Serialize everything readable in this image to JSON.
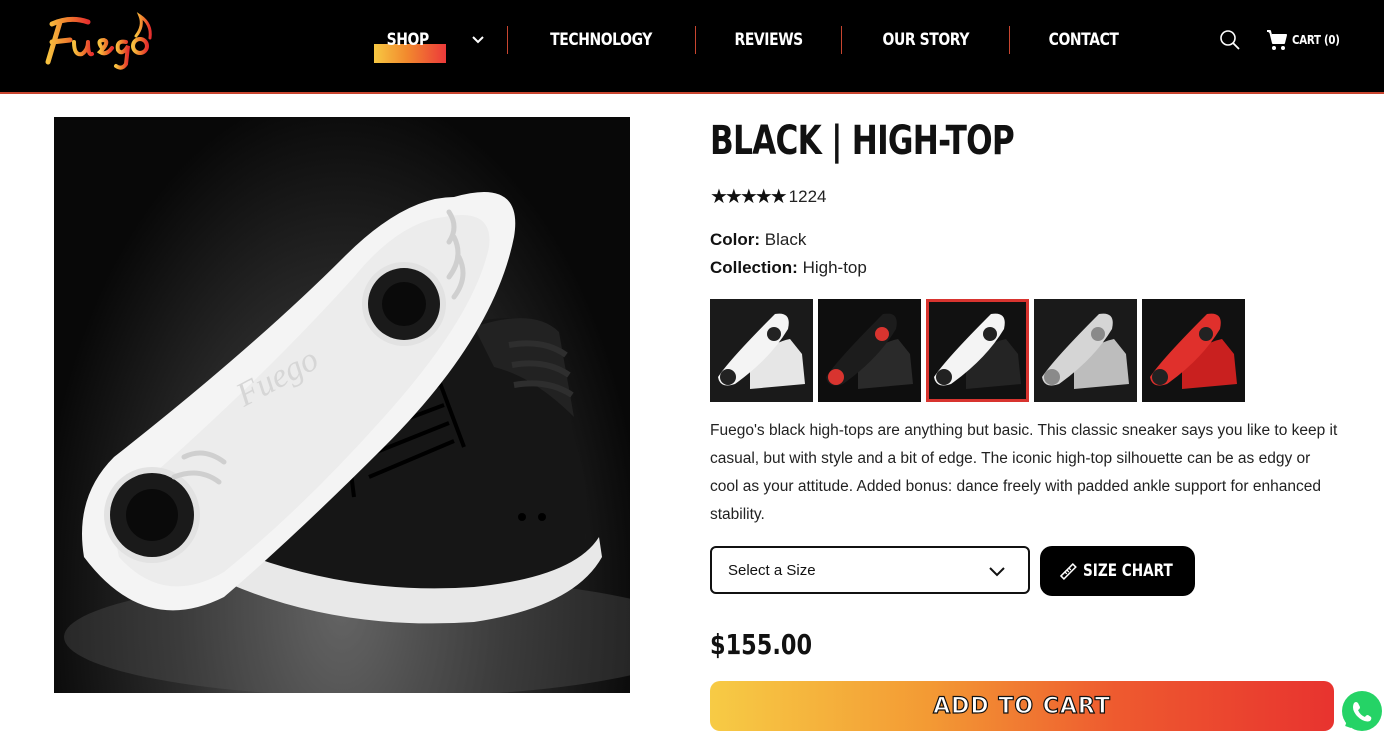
{
  "brand": {
    "logo_text": "Fuego"
  },
  "nav": {
    "items": [
      {
        "label": "SHOP"
      },
      {
        "label": "TECHNOLOGY"
      },
      {
        "label": "REVIEWS"
      },
      {
        "label": "OUR STORY"
      },
      {
        "label": "CONTACT"
      }
    ],
    "cart_label": "CART (0)"
  },
  "product": {
    "title": "BLACK | HIGH-TOP",
    "rating_stars": "★★★★★",
    "rating_value": 5,
    "review_count": "1224",
    "color_label": "Color:",
    "color_value": "Black",
    "collection_label": "Collection:",
    "collection_value": "High-top",
    "swatches": [
      {
        "name": "white",
        "selected": false
      },
      {
        "name": "black-red",
        "selected": false
      },
      {
        "name": "black",
        "selected": true
      },
      {
        "name": "silver",
        "selected": false
      },
      {
        "name": "red",
        "selected": false
      }
    ],
    "description": "Fuego's black high-tops are anything but basic. This classic sneaker says you like to keep it casual, but with style and a bit of edge. The iconic high-top silhouette can be as edgy or cool as your attitude. Added bonus: dance freely with padded ankle support for enhanced stability.",
    "size_select_value": "Select a Size",
    "size_chart_label": "SIZE CHART",
    "price": "$155.00",
    "add_to_cart_label": "ADD TO CART"
  },
  "colors": {
    "header_bg": "#000000",
    "accent_red": "#e8332f",
    "accent_yellow": "#f7cb45",
    "whatsapp_green": "#25d366"
  },
  "icons": [
    "chevron-down-icon",
    "search-icon",
    "cart-icon",
    "ruler-icon",
    "whatsapp-icon"
  ]
}
